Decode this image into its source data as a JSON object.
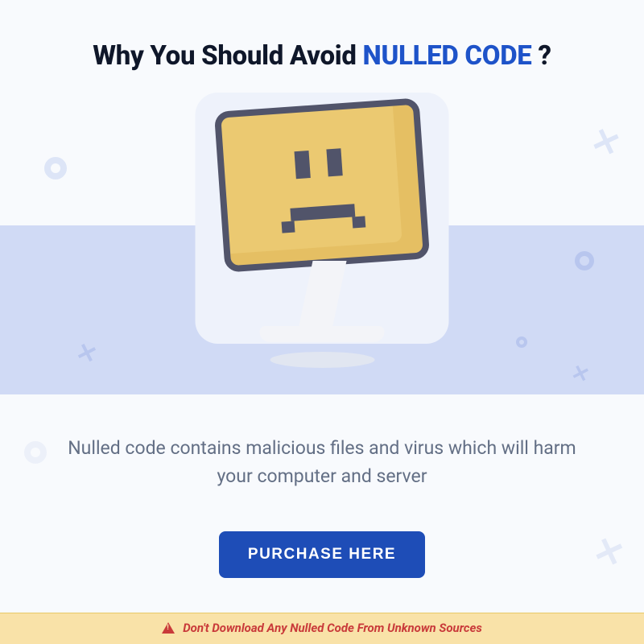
{
  "title": {
    "prefix": "Why You Should Avoid ",
    "highlight": "NULLED CODE",
    "suffix": " ?"
  },
  "description": "Nulled code contains malicious files and virus which will harm your computer and server",
  "button": {
    "label": "PURCHASE HERE"
  },
  "footer": {
    "warning": "Don't Download Any Nulled Code From Unknown Sources"
  },
  "colors": {
    "accent": "#1e4db7",
    "highlight_text": "#1e53c9",
    "band": "#d0daf5",
    "screen_fill": "#ebc971",
    "screen_border": "#51546a",
    "footer_bg": "#f9e2a8",
    "footer_text": "#c93a3a",
    "body_text": "#636f85"
  }
}
